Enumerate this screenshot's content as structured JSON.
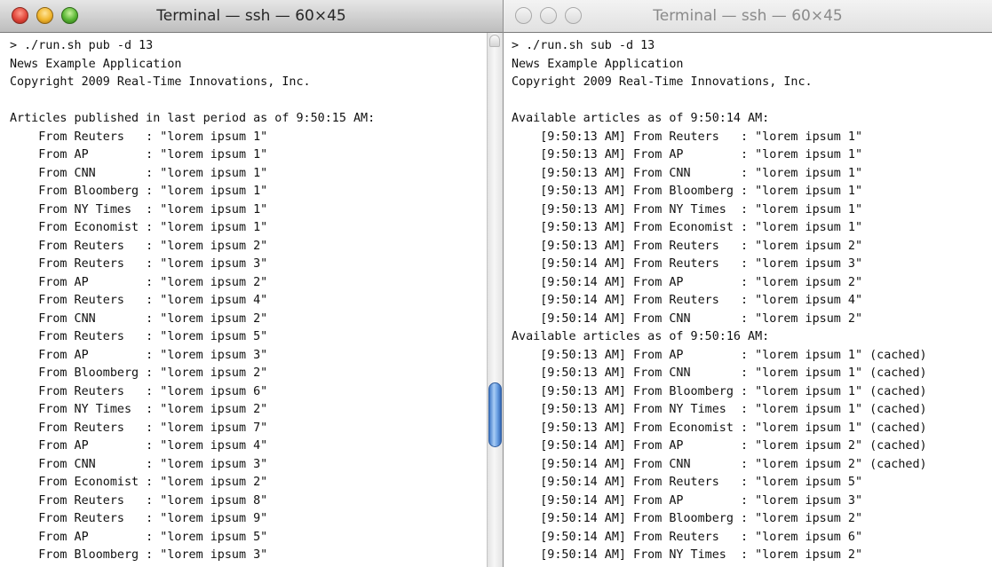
{
  "left_window": {
    "title": "Terminal — ssh — 60×45",
    "lines": [
      "> ./run.sh pub -d 13",
      "News Example Application",
      "Copyright 2009 Real-Time Innovations, Inc.",
      "",
      "Articles published in last period as of 9:50:15 AM:",
      "    From Reuters   : \"lorem ipsum 1\"",
      "    From AP        : \"lorem ipsum 1\"",
      "    From CNN       : \"lorem ipsum 1\"",
      "    From Bloomberg : \"lorem ipsum 1\"",
      "    From NY Times  : \"lorem ipsum 1\"",
      "    From Economist : \"lorem ipsum 1\"",
      "    From Reuters   : \"lorem ipsum 2\"",
      "    From Reuters   : \"lorem ipsum 3\"",
      "    From AP        : \"lorem ipsum 2\"",
      "    From Reuters   : \"lorem ipsum 4\"",
      "    From CNN       : \"lorem ipsum 2\"",
      "    From Reuters   : \"lorem ipsum 5\"",
      "    From AP        : \"lorem ipsum 3\"",
      "    From Bloomberg : \"lorem ipsum 2\"",
      "    From Reuters   : \"lorem ipsum 6\"",
      "    From NY Times  : \"lorem ipsum 2\"",
      "    From Reuters   : \"lorem ipsum 7\"",
      "    From AP        : \"lorem ipsum 4\"",
      "    From CNN       : \"lorem ipsum 3\"",
      "    From Economist : \"lorem ipsum 2\"",
      "    From Reuters   : \"lorem ipsum 8\"",
      "    From Reuters   : \"lorem ipsum 9\"",
      "    From AP        : \"lorem ipsum 5\"",
      "    From Bloomberg : \"lorem ipsum 3\""
    ]
  },
  "right_window": {
    "title": "Terminal — ssh — 60×45",
    "lines": [
      "> ./run.sh sub -d 13",
      "News Example Application",
      "Copyright 2009 Real-Time Innovations, Inc.",
      "",
      "Available articles as of 9:50:14 AM:",
      "    [9:50:13 AM] From Reuters   : \"lorem ipsum 1\"",
      "    [9:50:13 AM] From AP        : \"lorem ipsum 1\"",
      "    [9:50:13 AM] From CNN       : \"lorem ipsum 1\"",
      "    [9:50:13 AM] From Bloomberg : \"lorem ipsum 1\"",
      "    [9:50:13 AM] From NY Times  : \"lorem ipsum 1\"",
      "    [9:50:13 AM] From Economist : \"lorem ipsum 1\"",
      "    [9:50:13 AM] From Reuters   : \"lorem ipsum 2\"",
      "    [9:50:14 AM] From Reuters   : \"lorem ipsum 3\"",
      "    [9:50:14 AM] From AP        : \"lorem ipsum 2\"",
      "    [9:50:14 AM] From Reuters   : \"lorem ipsum 4\"",
      "    [9:50:14 AM] From CNN       : \"lorem ipsum 2\"",
      "Available articles as of 9:50:16 AM:",
      "    [9:50:13 AM] From AP        : \"lorem ipsum 1\" (cached)",
      "    [9:50:13 AM] From CNN       : \"lorem ipsum 1\" (cached)",
      "    [9:50:13 AM] From Bloomberg : \"lorem ipsum 1\" (cached)",
      "    [9:50:13 AM] From NY Times  : \"lorem ipsum 1\" (cached)",
      "    [9:50:13 AM] From Economist : \"lorem ipsum 1\" (cached)",
      "    [9:50:14 AM] From AP        : \"lorem ipsum 2\" (cached)",
      "    [9:50:14 AM] From CNN       : \"lorem ipsum 2\" (cached)",
      "    [9:50:14 AM] From Reuters   : \"lorem ipsum 5\"",
      "    [9:50:14 AM] From AP        : \"lorem ipsum 3\"",
      "    [9:50:14 AM] From Bloomberg : \"lorem ipsum 2\"",
      "    [9:50:14 AM] From Reuters   : \"lorem ipsum 6\"",
      "    [9:50:14 AM] From NY Times  : \"lorem ipsum 2\""
    ]
  },
  "colors": {
    "close": "#e0463a",
    "minimize": "#f0b52c",
    "zoom": "#58b533",
    "scroll_thumb": "#6aa0e3"
  },
  "icons": [
    "close-icon",
    "minimize-icon",
    "zoom-icon"
  ]
}
